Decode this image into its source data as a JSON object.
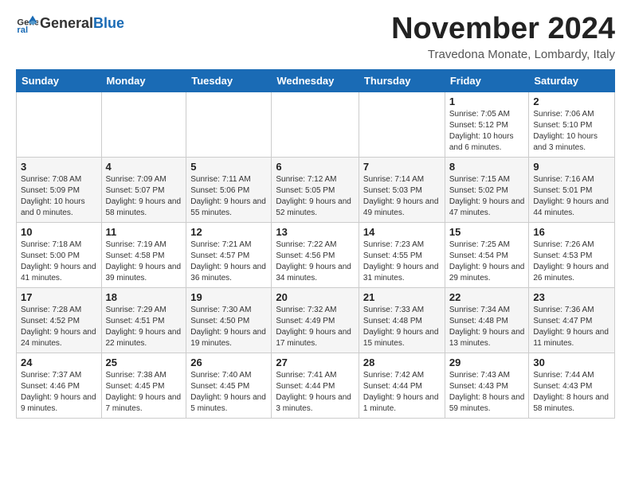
{
  "header": {
    "logo_line1": "General",
    "logo_line2": "Blue",
    "month_title": "November 2024",
    "location": "Travedona Monate, Lombardy, Italy"
  },
  "weekdays": [
    "Sunday",
    "Monday",
    "Tuesday",
    "Wednesday",
    "Thursday",
    "Friday",
    "Saturday"
  ],
  "rows": [
    [
      {
        "day": "",
        "info": ""
      },
      {
        "day": "",
        "info": ""
      },
      {
        "day": "",
        "info": ""
      },
      {
        "day": "",
        "info": ""
      },
      {
        "day": "",
        "info": ""
      },
      {
        "day": "1",
        "info": "Sunrise: 7:05 AM\nSunset: 5:12 PM\nDaylight: 10 hours and 6 minutes."
      },
      {
        "day": "2",
        "info": "Sunrise: 7:06 AM\nSunset: 5:10 PM\nDaylight: 10 hours and 3 minutes."
      }
    ],
    [
      {
        "day": "3",
        "info": "Sunrise: 7:08 AM\nSunset: 5:09 PM\nDaylight: 10 hours and 0 minutes."
      },
      {
        "day": "4",
        "info": "Sunrise: 7:09 AM\nSunset: 5:07 PM\nDaylight: 9 hours and 58 minutes."
      },
      {
        "day": "5",
        "info": "Sunrise: 7:11 AM\nSunset: 5:06 PM\nDaylight: 9 hours and 55 minutes."
      },
      {
        "day": "6",
        "info": "Sunrise: 7:12 AM\nSunset: 5:05 PM\nDaylight: 9 hours and 52 minutes."
      },
      {
        "day": "7",
        "info": "Sunrise: 7:14 AM\nSunset: 5:03 PM\nDaylight: 9 hours and 49 minutes."
      },
      {
        "day": "8",
        "info": "Sunrise: 7:15 AM\nSunset: 5:02 PM\nDaylight: 9 hours and 47 minutes."
      },
      {
        "day": "9",
        "info": "Sunrise: 7:16 AM\nSunset: 5:01 PM\nDaylight: 9 hours and 44 minutes."
      }
    ],
    [
      {
        "day": "10",
        "info": "Sunrise: 7:18 AM\nSunset: 5:00 PM\nDaylight: 9 hours and 41 minutes."
      },
      {
        "day": "11",
        "info": "Sunrise: 7:19 AM\nSunset: 4:58 PM\nDaylight: 9 hours and 39 minutes."
      },
      {
        "day": "12",
        "info": "Sunrise: 7:21 AM\nSunset: 4:57 PM\nDaylight: 9 hours and 36 minutes."
      },
      {
        "day": "13",
        "info": "Sunrise: 7:22 AM\nSunset: 4:56 PM\nDaylight: 9 hours and 34 minutes."
      },
      {
        "day": "14",
        "info": "Sunrise: 7:23 AM\nSunset: 4:55 PM\nDaylight: 9 hours and 31 minutes."
      },
      {
        "day": "15",
        "info": "Sunrise: 7:25 AM\nSunset: 4:54 PM\nDaylight: 9 hours and 29 minutes."
      },
      {
        "day": "16",
        "info": "Sunrise: 7:26 AM\nSunset: 4:53 PM\nDaylight: 9 hours and 26 minutes."
      }
    ],
    [
      {
        "day": "17",
        "info": "Sunrise: 7:28 AM\nSunset: 4:52 PM\nDaylight: 9 hours and 24 minutes."
      },
      {
        "day": "18",
        "info": "Sunrise: 7:29 AM\nSunset: 4:51 PM\nDaylight: 9 hours and 22 minutes."
      },
      {
        "day": "19",
        "info": "Sunrise: 7:30 AM\nSunset: 4:50 PM\nDaylight: 9 hours and 19 minutes."
      },
      {
        "day": "20",
        "info": "Sunrise: 7:32 AM\nSunset: 4:49 PM\nDaylight: 9 hours and 17 minutes."
      },
      {
        "day": "21",
        "info": "Sunrise: 7:33 AM\nSunset: 4:48 PM\nDaylight: 9 hours and 15 minutes."
      },
      {
        "day": "22",
        "info": "Sunrise: 7:34 AM\nSunset: 4:48 PM\nDaylight: 9 hours and 13 minutes."
      },
      {
        "day": "23",
        "info": "Sunrise: 7:36 AM\nSunset: 4:47 PM\nDaylight: 9 hours and 11 minutes."
      }
    ],
    [
      {
        "day": "24",
        "info": "Sunrise: 7:37 AM\nSunset: 4:46 PM\nDaylight: 9 hours and 9 minutes."
      },
      {
        "day": "25",
        "info": "Sunrise: 7:38 AM\nSunset: 4:45 PM\nDaylight: 9 hours and 7 minutes."
      },
      {
        "day": "26",
        "info": "Sunrise: 7:40 AM\nSunset: 4:45 PM\nDaylight: 9 hours and 5 minutes."
      },
      {
        "day": "27",
        "info": "Sunrise: 7:41 AM\nSunset: 4:44 PM\nDaylight: 9 hours and 3 minutes."
      },
      {
        "day": "28",
        "info": "Sunrise: 7:42 AM\nSunset: 4:44 PM\nDaylight: 9 hours and 1 minute."
      },
      {
        "day": "29",
        "info": "Sunrise: 7:43 AM\nSunset: 4:43 PM\nDaylight: 8 hours and 59 minutes."
      },
      {
        "day": "30",
        "info": "Sunrise: 7:44 AM\nSunset: 4:43 PM\nDaylight: 8 hours and 58 minutes."
      }
    ]
  ]
}
